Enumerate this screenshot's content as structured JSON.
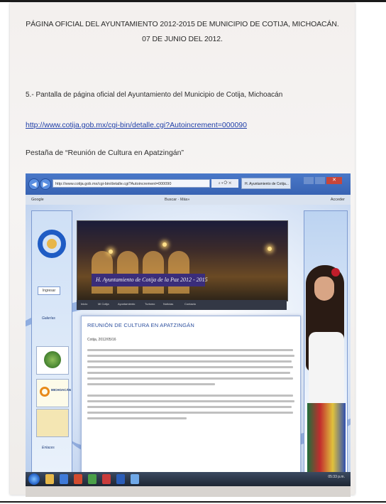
{
  "document": {
    "heading_line1": "PÁGINA OFICIAL DEL AYUNTAMIENTO 2012-2015 DE MUNICIPIO DE COTIJA, MICHOACÁN.",
    "heading_line2": "07 DE JUNIO DEL 2012.",
    "caption": "5.- Pantalla de página oficial del Ayuntamiento del Municipio de Cotija, Michoacán",
    "url": "http://www.cotija.gob.mx/cgi-bin/detalle.cgi?Autoincrement=000090",
    "tab_caption": "Pestaña de “Reunión de Cultura en Apatzingán”"
  },
  "screenshot": {
    "address": "http://www.cotija.gob.mx/cgi-bin/detalle.cgi?Autoincrement=000090",
    "tab_label": "H. Ayuntamiento de Cotija...",
    "toolbar_google": "Google",
    "toolbar_buscar": "Buscar · Más»",
    "toolbar_acceder": "Acceder",
    "login_label": "Ingresar",
    "sidebar_label_top": "Galerías",
    "sidebar_label_bottom": "Enlaces",
    "card_text": "MICHOACÁN",
    "banner_text": "H. Ayuntamiento de Cotija de la Paz 2012 - 2015",
    "nav_items": [
      "Inicio",
      "Mi Cotija",
      "Ayuntamiento",
      "Turismo",
      "Noticias",
      "Contacto"
    ],
    "article_title": "REUNIÓN DE CULTURA EN APATZINGÁN",
    "article_date": "Cotija, 2012/05/16",
    "clock": "05:33 p.m."
  },
  "colors": {
    "link": "#1f3ea8",
    "browser_chrome": "#3863b3",
    "article_title": "#2c4f9e"
  }
}
